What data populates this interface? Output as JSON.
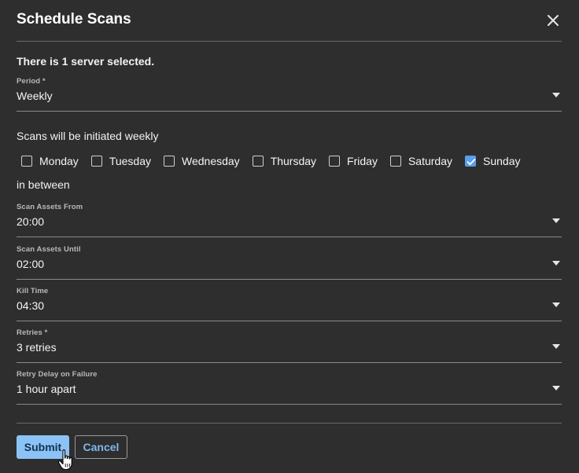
{
  "dialog": {
    "title": "Schedule Scans",
    "selection_text": "There is 1 server selected."
  },
  "period": {
    "label": "Period *",
    "value": "Weekly"
  },
  "schedule_text": "Scans will be initiated weekly",
  "days": [
    {
      "label": "Monday",
      "checked": false
    },
    {
      "label": "Tuesday",
      "checked": false
    },
    {
      "label": "Wednesday",
      "checked": false
    },
    {
      "label": "Thursday",
      "checked": false
    },
    {
      "label": "Friday",
      "checked": false
    },
    {
      "label": "Saturday",
      "checked": false
    },
    {
      "label": "Sunday",
      "checked": true
    }
  ],
  "between_text": "in between",
  "scan_from": {
    "label": "Scan Assets From",
    "value": "20:00"
  },
  "scan_until": {
    "label": "Scan Assets Until",
    "value": "02:00"
  },
  "kill_time": {
    "label": "Kill Time",
    "value": "04:30"
  },
  "retries": {
    "label": "Retries *",
    "value": "3 retries"
  },
  "retry_delay": {
    "label": "Retry Delay on Failure",
    "value": "1 hour apart"
  },
  "actions": {
    "submit_label": "Submit",
    "cancel_label": "Cancel"
  },
  "colors": {
    "background": "#2e2e2e",
    "accent": "#5b9ee9",
    "submit_bg": "#8bc3f7",
    "cancel_text": "#7fb6ee"
  }
}
